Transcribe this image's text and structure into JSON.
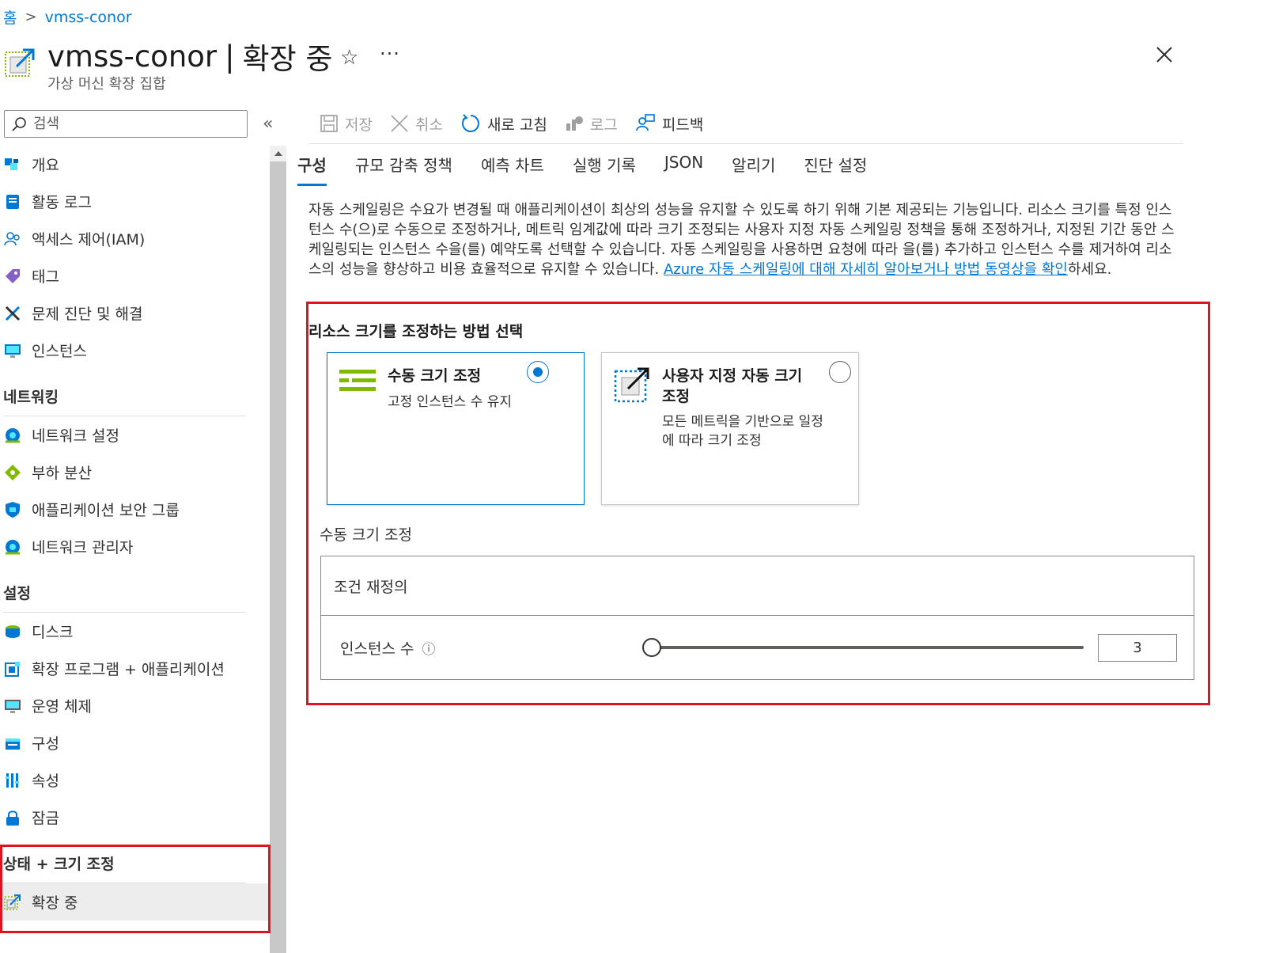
{
  "breadcrumb": {
    "home": "홈",
    "separator": ">",
    "current": "vmss-conor"
  },
  "header": {
    "resource_name": "vmss-conor",
    "separator": "|",
    "blade_name": "확장 중",
    "subtitle": "가상 머신 확장 집합",
    "star_glyph": "☆",
    "more_glyph": "···"
  },
  "sidebar": {
    "search_placeholder": "검색",
    "collapse_glyph": "«",
    "items_top": [
      {
        "label": "개요",
        "icon": "overview-icon"
      },
      {
        "label": "활동 로그",
        "icon": "activity-log-icon"
      },
      {
        "label": "액세스 제어(IAM)",
        "icon": "iam-icon"
      },
      {
        "label": "태그",
        "icon": "tag-icon"
      },
      {
        "label": "문제 진단 및 해결",
        "icon": "diagnose-icon"
      },
      {
        "label": "인스턴스",
        "icon": "instances-icon"
      }
    ],
    "section_networking": "네트워킹",
    "items_networking": [
      {
        "label": "네트워크 설정",
        "icon": "network-settings-icon"
      },
      {
        "label": "부하 분산",
        "icon": "load-balancing-icon"
      },
      {
        "label": "애플리케이션 보안 그룹",
        "icon": "asg-icon"
      },
      {
        "label": "네트워크 관리자",
        "icon": "network-manager-icon"
      }
    ],
    "section_settings": "설정",
    "items_settings": [
      {
        "label": "디스크",
        "icon": "disk-icon"
      },
      {
        "label": "확장 프로그램 + 애플리케이션",
        "icon": "extensions-icon"
      },
      {
        "label": "운영 체제",
        "icon": "os-icon"
      },
      {
        "label": "구성",
        "icon": "configuration-icon"
      },
      {
        "label": "속성",
        "icon": "properties-icon"
      },
      {
        "label": "잠금",
        "icon": "lock-icon"
      }
    ],
    "section_health": "상태 + 크기 조정",
    "items_health": [
      {
        "label": "확장 중",
        "icon": "scaling-icon",
        "active": true
      }
    ]
  },
  "toolbar": {
    "save": "저장",
    "cancel": "취소",
    "refresh": "새로 고침",
    "logs": "로그",
    "feedback": "피드백"
  },
  "tabs": [
    "구성",
    "규모 감축 정책",
    "예측 차트",
    "실행 기록",
    "JSON",
    "알리기",
    "진단 설정"
  ],
  "description": {
    "text": "자동 스케일링은 수요가 변경될 때 애플리케이션이 최상의 성능을 유지할 수 있도록 하기 위해 기본 제공되는 기능입니다. 리소스 크기를 특정 인스턴스 수(으)로 수동으로 조정하거나, 메트릭 임계값에 따라 크기 조정되는 사용자 지정 자동 스케일링 정책을 통해 조정하거나, 지정된 기간 동안 스케일링되는 인스턴스 수을(를) 예약도록 선택할 수 있습니다. 자동 스케일링을 사용하면 요청에 따라 을(를) 추가하고 인스턴스 수를 제거하여 리소스의 성능을 향상하고 비용 효율적으로 유지할 수 있습니다. ",
    "link": "Azure 자동 스케일링에 대해 자세히 알아보거나 방법 동영상을 확인",
    "suffix": "하세요."
  },
  "scale_method": {
    "heading": "리소스 크기를 조정하는 방법 선택",
    "manual_title": "수동 크기 조정",
    "manual_desc": "고정 인스턴스 수 유지",
    "manual_selected": true,
    "custom_title": "사용자 지정 자동 크기 조정",
    "custom_desc": "모든 메트릭을 기반으로 일정에 따라 크기 조정",
    "custom_selected": false
  },
  "manual_scale": {
    "label": "수동 크기 조정",
    "override_label": "조건 재정의",
    "instance_count_label": "인스턴스 수",
    "info_glyph": "ⓘ",
    "instance_count": "3",
    "slider_fraction": 0.0
  },
  "colors": {
    "accent": "#0078d4",
    "highlight": "#e3121f"
  }
}
